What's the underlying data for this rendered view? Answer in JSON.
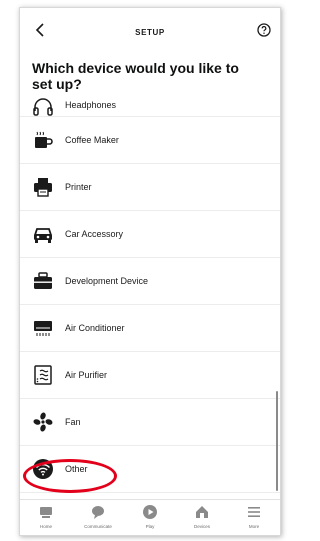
{
  "header": {
    "title": "SETUP",
    "back_icon": "chevron-left-icon",
    "help_icon": "question-circle-icon"
  },
  "heading": "Which device would you like to set up?",
  "devices": [
    {
      "label": "Headphones",
      "icon": "headphones-icon"
    },
    {
      "label": "Coffee Maker",
      "icon": "coffee-maker-icon"
    },
    {
      "label": "Printer",
      "icon": "printer-icon"
    },
    {
      "label": "Car Accessory",
      "icon": "car-icon"
    },
    {
      "label": "Development Device",
      "icon": "toolbox-icon"
    },
    {
      "label": "Air Conditioner",
      "icon": "air-conditioner-icon"
    },
    {
      "label": "Air Purifier",
      "icon": "air-purifier-icon"
    },
    {
      "label": "Fan",
      "icon": "fan-icon"
    },
    {
      "label": "Other",
      "icon": "wireless-icon"
    }
  ],
  "nav": [
    {
      "label": "Home",
      "icon": "home-icon"
    },
    {
      "label": "Communicate",
      "icon": "chat-bubble-icon"
    },
    {
      "label": "Play",
      "icon": "play-icon"
    },
    {
      "label": "Devices",
      "icon": "devices-icon"
    },
    {
      "label": "More",
      "icon": "menu-icon"
    }
  ],
  "colors": {
    "highlight": "#e3001b",
    "icon": "#1b1b1b",
    "nav_icon": "#8a8a8a"
  }
}
